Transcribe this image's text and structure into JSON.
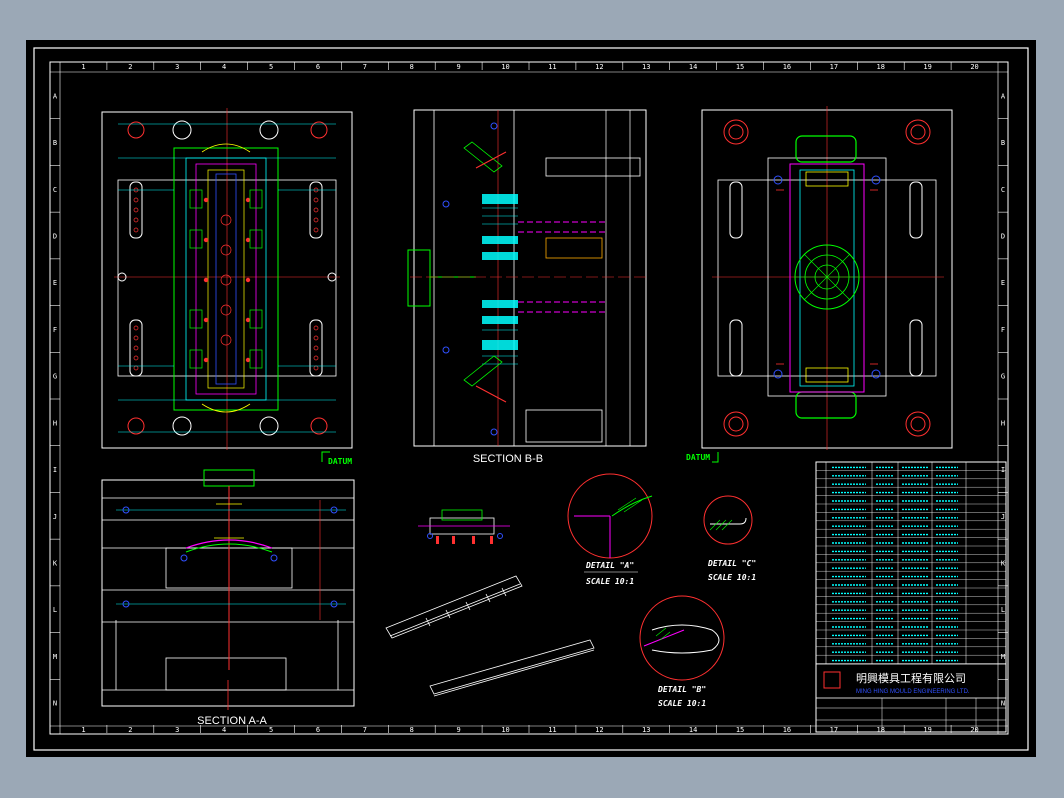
{
  "drawing": {
    "col_numbers": [
      "1",
      "2",
      "3",
      "4",
      "5",
      "6",
      "7",
      "8",
      "9",
      "10",
      "11",
      "12",
      "13",
      "14",
      "15",
      "16",
      "17",
      "18",
      "19",
      "20"
    ],
    "row_letters": [
      "A",
      "B",
      "C",
      "D",
      "E",
      "F",
      "G",
      "H",
      "I",
      "J",
      "K",
      "L",
      "M",
      "N"
    ],
    "section_aa_label": "SECTION A-A",
    "section_bb_label": "SECTION B-B",
    "datum_left": "DATUM",
    "datum_right": "DATUM",
    "detail_a": {
      "title": "DETAIL \"A\"",
      "scale": "SCALE 10:1"
    },
    "detail_b": {
      "title": "DETAIL \"B\"",
      "scale": "SCALE 10:1"
    },
    "detail_c": {
      "title": "DETAIL \"C\"",
      "scale": "SCALE 10:1"
    },
    "company_cn": "明興模具工程有限公司",
    "company_en": "MING HING MOULD ENGINEERING LTD.",
    "colors": {
      "background": "#000000",
      "border": "#ffffff",
      "cyan": "#00ffff",
      "green": "#00ff00",
      "red": "#ff0000",
      "magenta": "#ff00ff",
      "yellow": "#ffff00",
      "blue": "#3050ff",
      "window": "#9ba8b6"
    }
  }
}
